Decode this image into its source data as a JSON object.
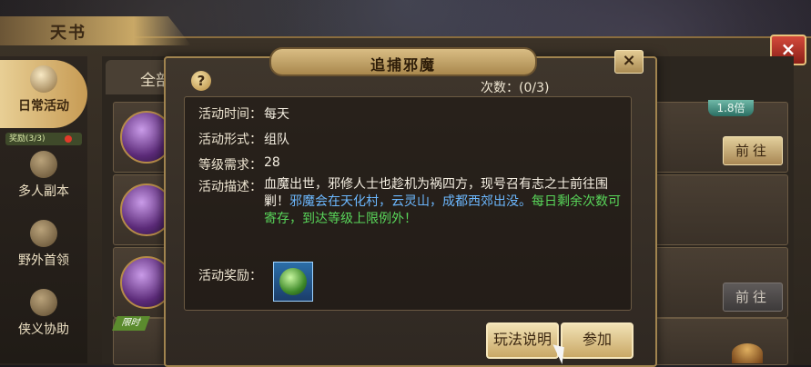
{
  "outer": {
    "title": "天书",
    "close": "×"
  },
  "sidebar": {
    "items": [
      {
        "label": "日常活动",
        "icon": "scroll-icon"
      },
      {
        "label": "多人副本",
        "icon": "dungeon-icon"
      },
      {
        "label": "野外首领",
        "icon": "boss-icon"
      },
      {
        "label": "侠义协助",
        "icon": "help-hero-icon"
      }
    ],
    "reward_badge": "奖励(3/3)"
  },
  "content": {
    "tab_label": "全部",
    "multiplier": "1.8倍",
    "go_label": "前往",
    "time_tag": "限时"
  },
  "dialog": {
    "title": "追捕邪魔",
    "close": "×",
    "help": "?",
    "count": "次数：(0/3)",
    "time_label": "活动时间：",
    "time_value": "每天",
    "form_label": "活动形式：",
    "form_value": "组队",
    "level_label": "等级需求：",
    "level_value": "28",
    "desc_label": "活动描述：",
    "desc_white": "血魔出世，邪修人士也趁机为祸四方，现号召有志之士前往围剿！",
    "desc_blue": "邪魔会在天化村，云灵山，成都西郊出没。",
    "desc_green": "每日剩余次数可寄存，到达等级上限例外！",
    "reward_label": "活动奖励：",
    "btn_rules": "玩法说明",
    "btn_join": "参加"
  },
  "colors": {
    "accent": "#c9a866",
    "blue_text": "#6cb8ff",
    "green_text": "#59d65a",
    "close_red": "#d34a3b"
  }
}
